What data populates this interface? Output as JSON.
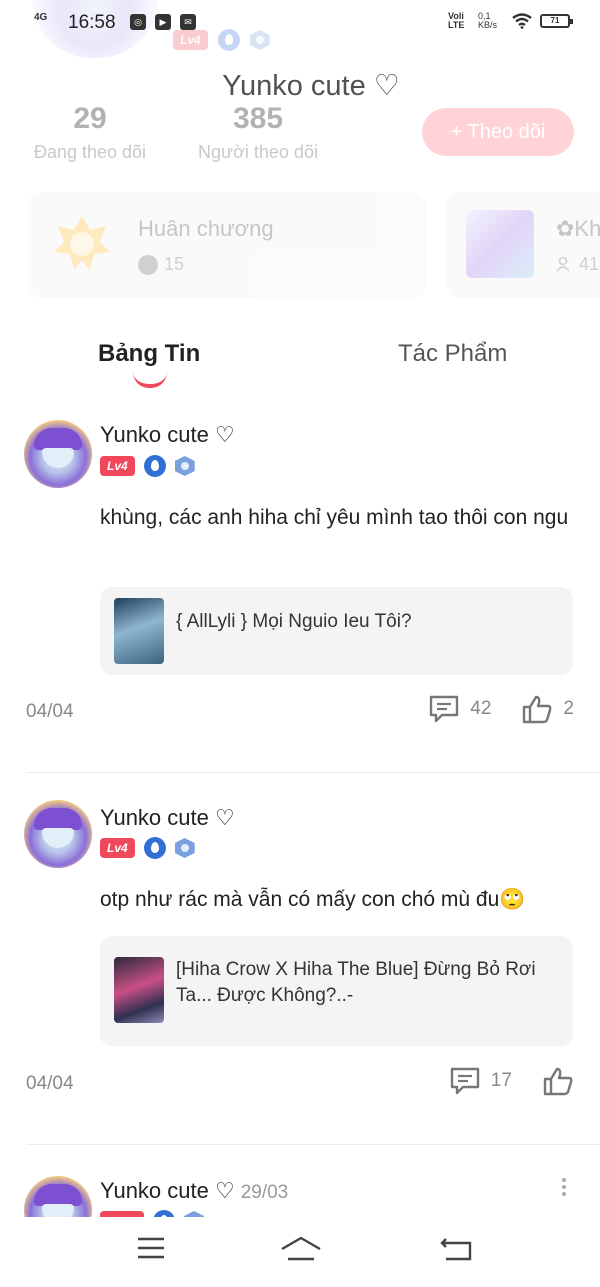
{
  "status_bar": {
    "network": "4G",
    "time": "16:58",
    "volte": "Voli LTE",
    "speed": "0,1 KB/s",
    "battery": "71"
  },
  "profile": {
    "name": "Yunko cute ♡",
    "level": "Lv4",
    "following_count": "29",
    "following_label": "Đang theo dõi",
    "followers_count": "385",
    "followers_label": "Người theo dõi",
    "follow_button": "+ Theo dõi"
  },
  "cards": {
    "medal_title": "Huân chương",
    "medal_count": "15",
    "club_title": "✿Kh",
    "club_count": "41"
  },
  "tabs": {
    "feed": "Bảng Tin",
    "works": "Tác Phẩm"
  },
  "posts": [
    {
      "author": "Yunko cute ♡",
      "level": "Lv4",
      "text": "khùng, các anh hiha chỉ yêu mình tao thôi con ngu",
      "attachment": "{ AllLyli } Mọi Nguio Ieu Tôi?",
      "date": "04/04",
      "comments": "42",
      "likes": "2"
    },
    {
      "author": "Yunko cute ♡",
      "level": "Lv4",
      "text": "otp như rác mà vẫn có mấy con chó mù đu🙄",
      "attachment": "[Hiha Crow X Hiha The Blue] Đừng Bỏ Rơi Ta... Được Không?..-",
      "date": "04/04",
      "comments": "17"
    },
    {
      "author": "Yunko cute ♡",
      "date": "29/03"
    }
  ],
  "colors": {
    "accent": "#f0475b",
    "follow_button_bg": "#ffd3d8",
    "badge_blue": "#2f6fd6"
  },
  "icons": [
    "menu-icon",
    "home-icon",
    "back-icon",
    "comment-icon",
    "like-icon",
    "more-icon",
    "medal-icon"
  ]
}
